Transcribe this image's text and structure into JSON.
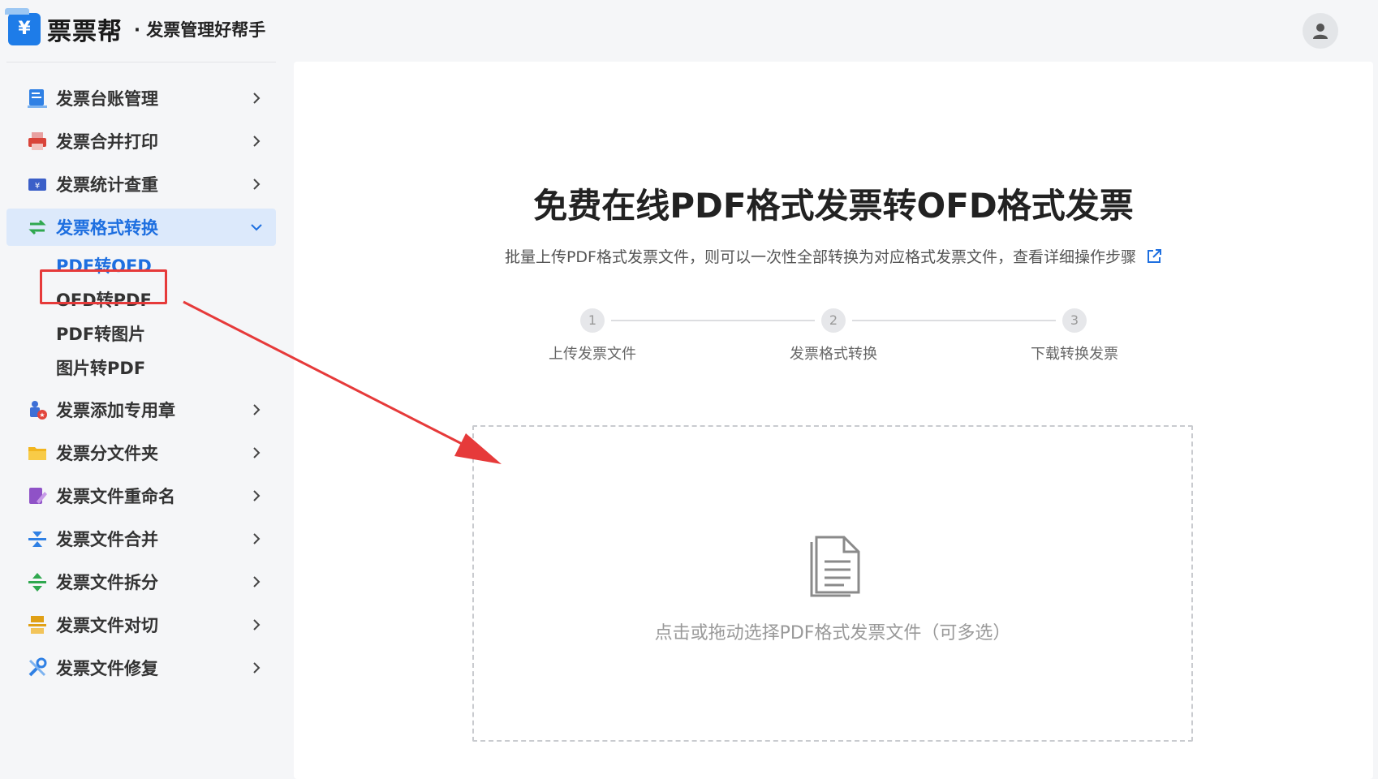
{
  "header": {
    "brand": "票票帮",
    "slogan": "· 发票管理好帮手",
    "logo_glyph": "¥",
    "user_icon": "user-icon"
  },
  "sidebar": {
    "items": [
      {
        "label": "发票台账管理",
        "icon": "ledger-icon",
        "color": "#2f80e4"
      },
      {
        "label": "发票合并打印",
        "icon": "printer-icon",
        "color": "#d9443a"
      },
      {
        "label": "发票统计查重",
        "icon": "statistics-icon",
        "color": "#3b5fc8"
      },
      {
        "label": "发票格式转换",
        "icon": "convert-icon",
        "color": "#2fa84f",
        "active": true
      },
      {
        "label": "发票添加专用章",
        "icon": "stamp-icon",
        "color": "#3d6fd6"
      },
      {
        "label": "发票分文件夹",
        "icon": "folder-icon",
        "color": "#f2b51e"
      },
      {
        "label": "发票文件重命名",
        "icon": "rename-icon",
        "color": "#8f52c7"
      },
      {
        "label": "发票文件合并",
        "icon": "merge-icon",
        "color": "#2f80e4"
      },
      {
        "label": "发票文件拆分",
        "icon": "split-icon",
        "color": "#2fa84f"
      },
      {
        "label": "发票文件对切",
        "icon": "cut-icon",
        "color": "#e0a016"
      },
      {
        "label": "发票文件修复",
        "icon": "repair-icon",
        "color": "#2f80e4"
      }
    ],
    "submenu": [
      {
        "label": "PDF转OFD",
        "active": true
      },
      {
        "label": "OFD转PDF"
      },
      {
        "label": "PDF转图片"
      },
      {
        "label": "图片转PDF"
      }
    ]
  },
  "main": {
    "title": "免费在线PDF格式发票转OFD格式发票",
    "subtitle": "批量上传PDF格式发票文件，则可以一次性全部转换为对应格式发票文件，查看详细操作步骤",
    "steps": [
      {
        "num": "1",
        "label": "上传发票文件"
      },
      {
        "num": "2",
        "label": "发票格式转换"
      },
      {
        "num": "3",
        "label": "下载转换发票"
      }
    ],
    "dropzone_text": "点击或拖动选择PDF格式发票文件（可多选）"
  },
  "colors": {
    "accent": "#1e6fe0",
    "active_bg": "#dce9fb",
    "annotation_red": "#e63a3a"
  }
}
